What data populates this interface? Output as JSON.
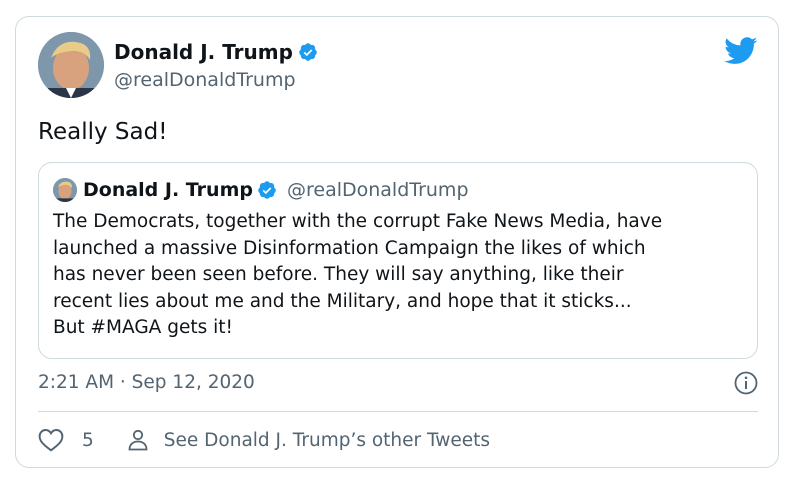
{
  "author": {
    "name": "Donald J. Trump",
    "handle": "@realDonaldTrump",
    "verified": true
  },
  "tweet": {
    "text": "Really Sad!",
    "timestamp": "2:21 AM · Sep 12, 2020",
    "like_count": "5",
    "other_tweets_label": "See Donald J. Trump’s other Tweets"
  },
  "quoted_tweet": {
    "name": "Donald J. Trump",
    "handle": "@realDonaldTrump",
    "text": "The Democrats, together with the corrupt Fake News Media, have\nlaunched a massive Disinformation Campaign the likes of which\nhas never been seen before. They will say anything, like their\nrecent lies about me and the Military, and hope that it sticks...\nBut #MAGA gets it!"
  },
  "icons": {
    "brand": "twitter-bird-icon",
    "verified": "verified-badge-icon",
    "info": "info-icon",
    "like": "heart-icon",
    "profile": "person-icon"
  },
  "colors": {
    "brand": "#1d9bf0",
    "text": "#0f1419",
    "secondary": "#536471",
    "border": "#cfd9de"
  }
}
